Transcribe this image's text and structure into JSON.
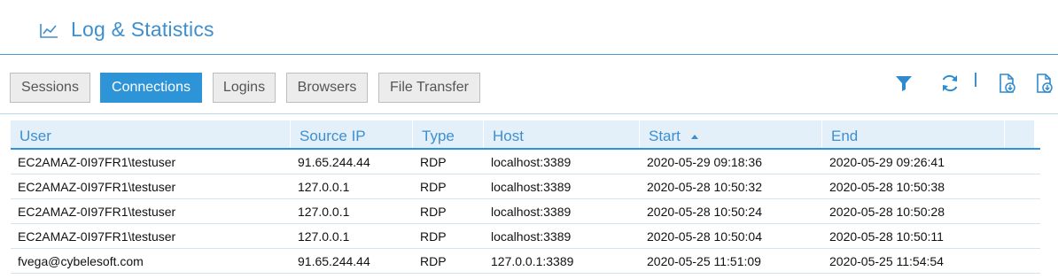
{
  "header": {
    "title": "Log & Statistics",
    "icon": "line-chart-icon"
  },
  "tabs": [
    {
      "label": "Sessions",
      "active": false
    },
    {
      "label": "Connections",
      "active": true
    },
    {
      "label": "Logins",
      "active": false
    },
    {
      "label": "Browsers",
      "active": false
    },
    {
      "label": "File Transfer",
      "active": false
    }
  ],
  "toolbar_icons": [
    "filter-icon",
    "refresh-icon",
    "export-pdf-icon",
    "export-csv-icon"
  ],
  "colors": {
    "accent": "#2e94d8",
    "title": "#3d8fd0",
    "header_bg": "#e3f0fa",
    "tab_bg": "#ececec"
  },
  "table": {
    "columns": [
      "User",
      "Source IP",
      "Type",
      "Host",
      "Start",
      "End"
    ],
    "sort": {
      "column": "Start",
      "direction": "ascending"
    },
    "rows": [
      [
        "EC2AMAZ-0I97FR1\\testuser",
        "91.65.244.44",
        "RDP",
        "localhost:3389",
        "2020-05-29 09:18:36",
        "2020-05-29 09:26:41"
      ],
      [
        "EC2AMAZ-0I97FR1\\testuser",
        "127.0.0.1",
        "RDP",
        "localhost:3389",
        "2020-05-28 10:50:32",
        "2020-05-28 10:50:38"
      ],
      [
        "EC2AMAZ-0I97FR1\\testuser",
        "127.0.0.1",
        "RDP",
        "localhost:3389",
        "2020-05-28 10:50:24",
        "2020-05-28 10:50:28"
      ],
      [
        "EC2AMAZ-0I97FR1\\testuser",
        "127.0.0.1",
        "RDP",
        "localhost:3389",
        "2020-05-28 10:50:04",
        "2020-05-28 10:50:11"
      ],
      [
        "fvega@cybelesoft.com",
        "91.65.244.44",
        "RDP",
        "127.0.0.1:3389",
        "2020-05-25 11:51:09",
        "2020-05-25 11:54:54"
      ]
    ]
  }
}
